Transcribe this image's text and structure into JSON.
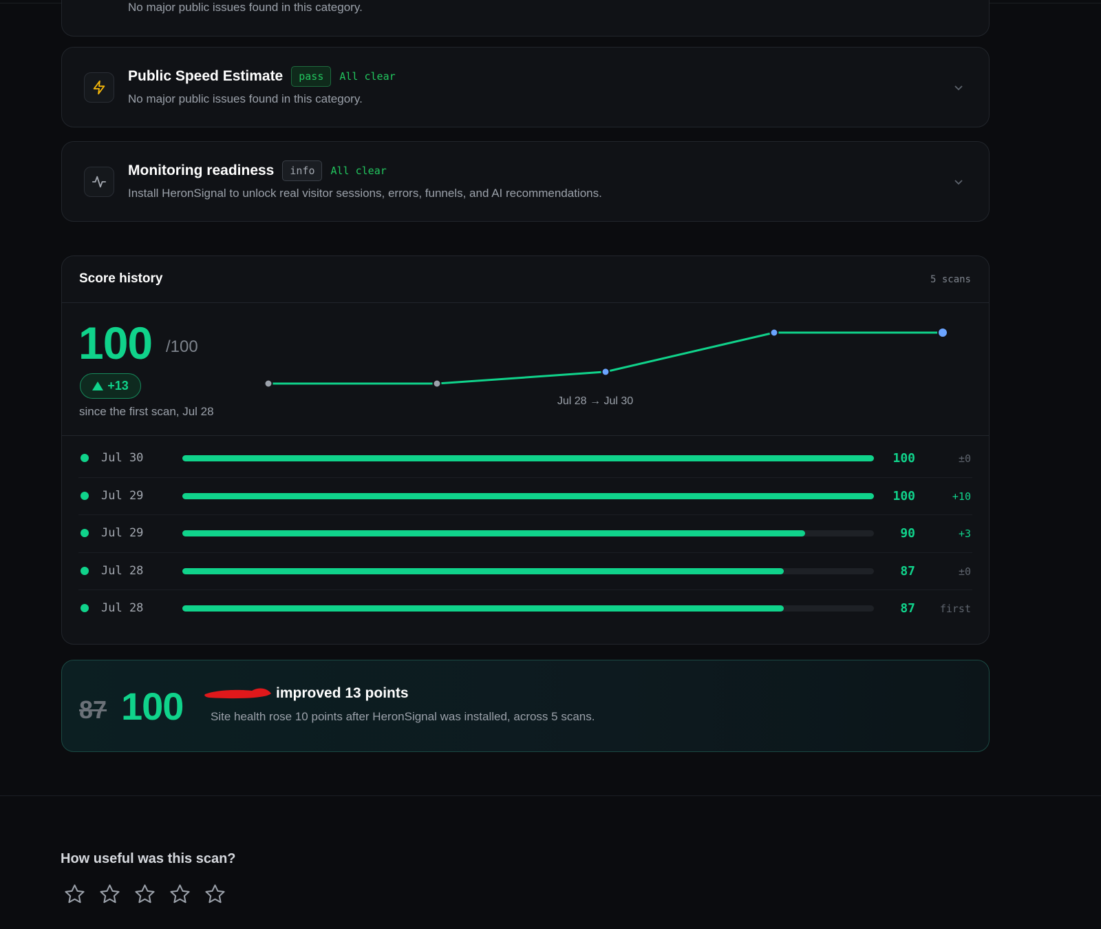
{
  "categories": [
    {
      "title": "",
      "badge": "",
      "status": "",
      "description": "No major public issues found in this category."
    },
    {
      "title": "Public Speed Estimate",
      "badge": "pass",
      "status": "All clear",
      "description": "No major public issues found in this category.",
      "icon": "lightning-icon"
    },
    {
      "title": "Monitoring readiness",
      "badge": "info",
      "status": "All clear",
      "description": "Install HeronSignal to unlock real visitor sessions, errors, funnels, and AI recommendations.",
      "icon": "activity-icon"
    }
  ],
  "score_history": {
    "title": "Score history",
    "scan_count": "5 scans",
    "current_score": "100",
    "max_score": "/100",
    "delta": "+13",
    "since": "since the first scan, Jul 28",
    "range_label": "Jul 28 → Jul 30",
    "sparkline": [
      87,
      87,
      90,
      100,
      100
    ],
    "rows": [
      {
        "date": "Jul 30",
        "score": 100,
        "score_text": "100",
        "delta": "±0"
      },
      {
        "date": "Jul 29",
        "score": 100,
        "score_text": "100",
        "delta": "+10"
      },
      {
        "date": "Jul 29",
        "score": 90,
        "score_text": "90",
        "delta": "+3"
      },
      {
        "date": "Jul 28",
        "score": 87,
        "score_text": "87",
        "delta": "±0"
      },
      {
        "date": "Jul 28",
        "score": 87,
        "score_text": "87",
        "delta": "first"
      }
    ]
  },
  "summary": {
    "old_score": "87",
    "new_score": "100",
    "title": "improved 13 points",
    "description": "Site health rose 10 points after HeronSignal was installed, across 5 scans."
  },
  "feedback": {
    "question": "How useful was this scan?",
    "rating": 0,
    "max_rating": 5
  },
  "colors": {
    "accent": "#10d38b",
    "pass": "#22c55e",
    "spark_point": "#6ba4ff",
    "redaction": "#e0181b"
  }
}
